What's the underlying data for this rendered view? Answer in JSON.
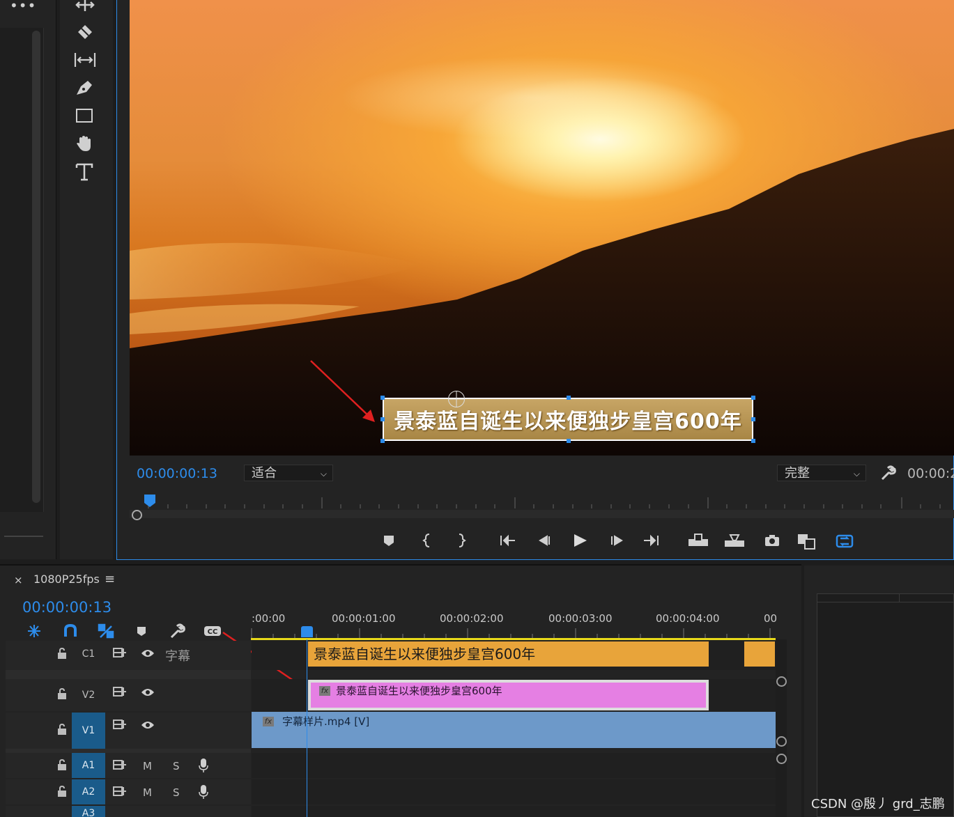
{
  "program_monitor": {
    "subtitle_text": "景泰蓝自诞生以来便独步皇宫600年",
    "timecode": "00:00:00:13",
    "zoom_dropdown": "适合",
    "quality_dropdown": "完整",
    "duration_partial": "00:00:2"
  },
  "timeline": {
    "sequence_name": "1080P25fps",
    "close_symbol": "×",
    "menu_symbol": "≡",
    "timecode": "00:00:00:13",
    "ruler_labels": [
      ":00:00",
      "00:00:01:00",
      "00:00:02:00",
      "00:00:03:00",
      "00:00:04:00",
      "00"
    ],
    "tracks": {
      "c1": {
        "name": "C1",
        "label": "字幕"
      },
      "v2": {
        "name": "V2"
      },
      "v1": {
        "name": "V1"
      },
      "a1": {
        "name": "A1",
        "m": "M",
        "s": "S"
      },
      "a2": {
        "name": "A2",
        "m": "M",
        "s": "S"
      },
      "a3": {
        "name": "A3"
      }
    },
    "clips": {
      "caption_clip": "景泰蓝自诞生以来便独步皇宫600年",
      "graphic_clip": "景泰蓝自诞生以来便独步皇宫600年",
      "video_clip": "字幕样片.mp4 [V]",
      "fx_label": "fx"
    }
  },
  "watermark": "CSDN @殷丿 grd_志鹏",
  "colors": {
    "accent_blue": "#2d8ceb",
    "caption_clip": "#e8a43a",
    "graphic_clip": "#e57fe3",
    "video_clip": "#6d99c9",
    "annotation_arrow": "#e02020"
  }
}
